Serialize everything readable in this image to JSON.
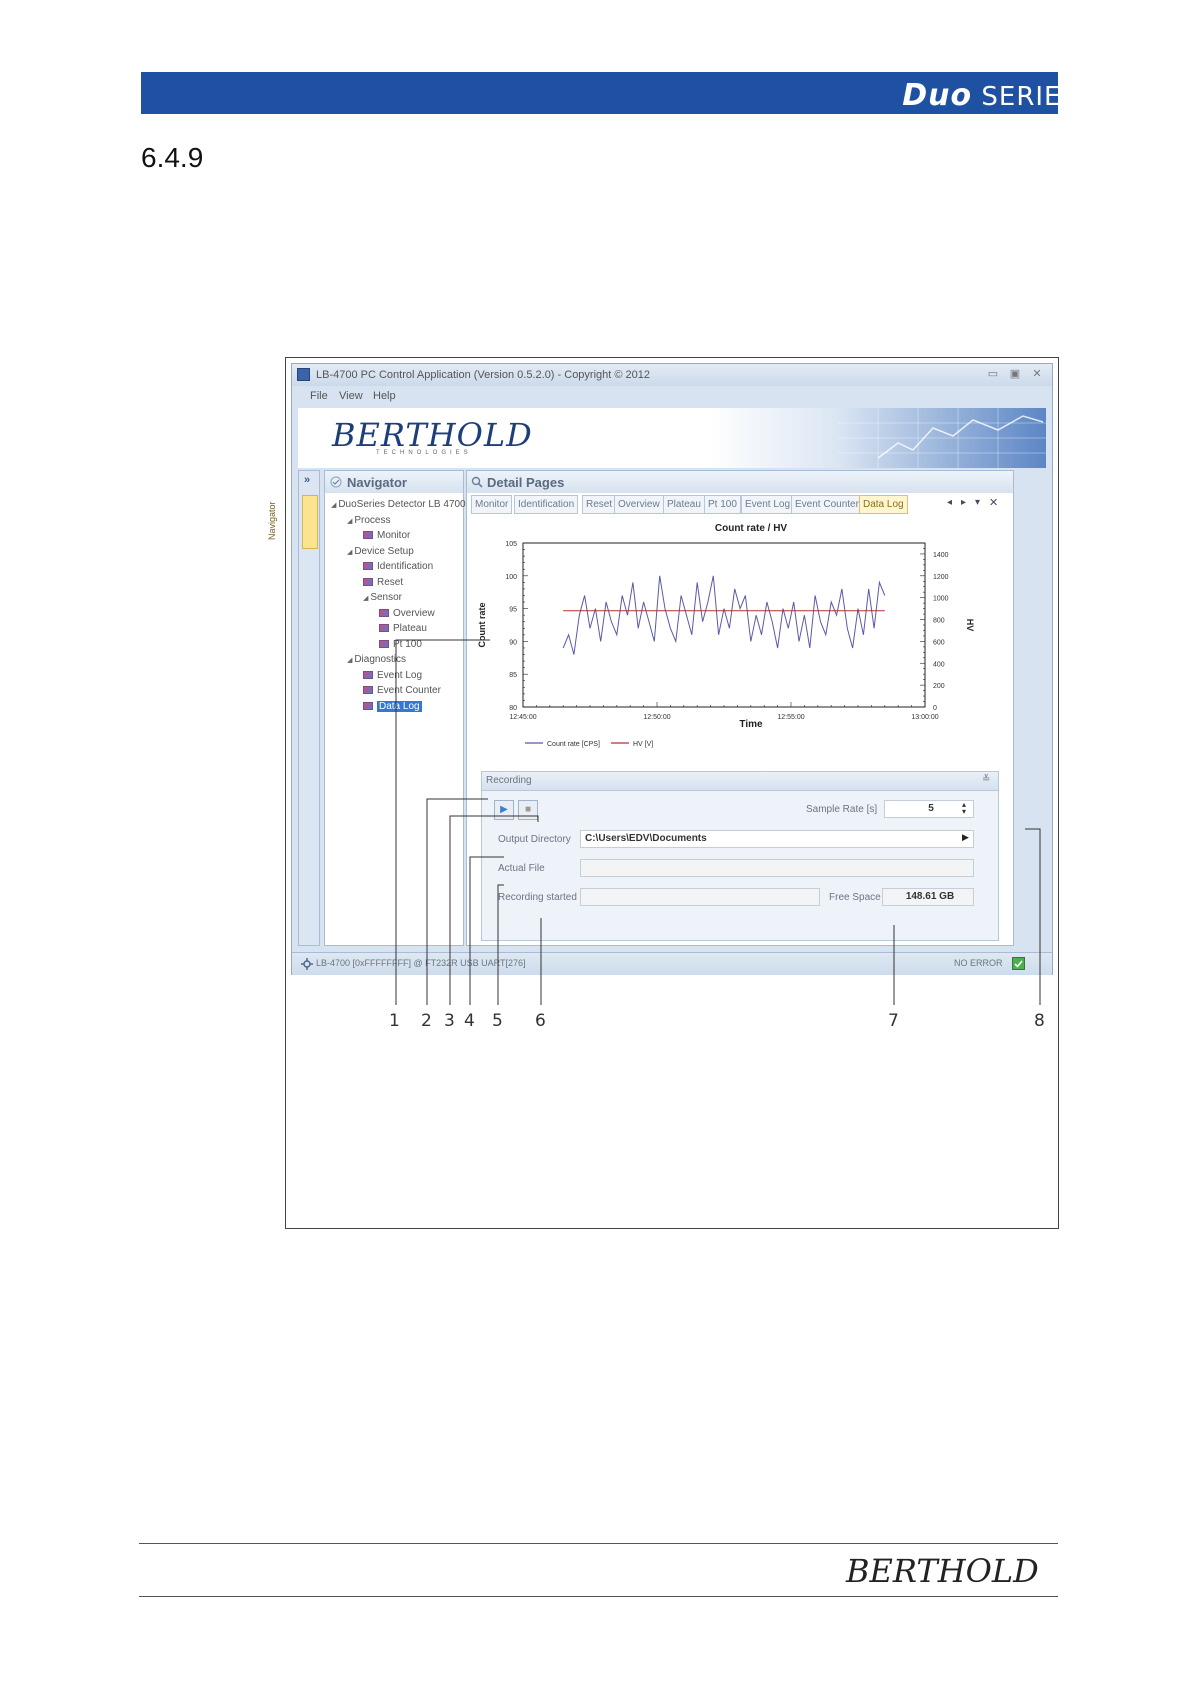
{
  "header": {
    "brand": "Duo",
    "series": "SERIES"
  },
  "section_number": "6.4.9",
  "window": {
    "title": "LB-4700 PC Control Application (Version 0.5.2.0) - Copyright © 2012",
    "controls": [
      "▭",
      "▣",
      "✕"
    ],
    "menu": [
      "File",
      "View",
      "Help"
    ],
    "logo": "BERTHOLD",
    "logo_sub": "TECHNOLOGIES"
  },
  "navigator": {
    "collapse_label": "»",
    "tab_label": "Navigator",
    "title": "Navigator",
    "tree": [
      {
        "label": "DuoSeries Detector LB 4700",
        "level": 0,
        "type": "folder"
      },
      {
        "label": "Process",
        "level": 1,
        "type": "folder"
      },
      {
        "label": "Monitor",
        "level": 2,
        "type": "page"
      },
      {
        "label": "Device Setup",
        "level": 1,
        "type": "folder"
      },
      {
        "label": "Identification",
        "level": 2,
        "type": "page"
      },
      {
        "label": "Reset",
        "level": 2,
        "type": "page"
      },
      {
        "label": "Sensor",
        "level": 2,
        "type": "folder"
      },
      {
        "label": "Overview",
        "level": 3,
        "type": "page"
      },
      {
        "label": "Plateau",
        "level": 3,
        "type": "page"
      },
      {
        "label": "Pt 100",
        "level": 3,
        "type": "page"
      },
      {
        "label": "Diagnostics",
        "level": 1,
        "type": "folder"
      },
      {
        "label": "Event Log",
        "level": 2,
        "type": "page"
      },
      {
        "label": "Event Counter",
        "level": 2,
        "type": "page"
      },
      {
        "label": "Data Log",
        "level": 2,
        "type": "page",
        "selected": true
      }
    ]
  },
  "detail": {
    "title": "Detail Pages",
    "tabs": [
      "Monitor",
      "Identification",
      "Reset",
      "Overview",
      "Plateau",
      "Pt 100",
      "Event Log",
      "Event Counter",
      "Data Log"
    ],
    "active_tab": "Data Log",
    "tab_controls": [
      "◂",
      "▸",
      "▾",
      "✕"
    ]
  },
  "chart_data": {
    "type": "line",
    "title": "Count rate / HV",
    "xlabel": "Time",
    "ylabel": "Count rate",
    "y2label": "HV",
    "x_ticks": [
      "12:45:00",
      "12:50:00",
      "12:55:00",
      "13:00:00"
    ],
    "y_ticks": [
      80,
      85,
      90,
      95,
      100,
      105
    ],
    "y2_ticks": [
      0,
      200,
      400,
      600,
      800,
      1000,
      1200,
      1400
    ],
    "ylim": [
      80,
      105
    ],
    "y2lim": [
      0,
      1500
    ],
    "xlim_min": [
      0,
      15
    ],
    "legend": [
      "Count rate [CPS]",
      "HV [V]"
    ],
    "colors": {
      "count": "#5a5aa8",
      "hv": "#b03030"
    },
    "series": [
      {
        "name": "Count rate [CPS]",
        "axis": "left",
        "x_min": [
          1.5,
          1.7,
          1.9,
          2.1,
          2.3,
          2.5,
          2.7,
          2.9,
          3.1,
          3.3,
          3.5,
          3.7,
          3.9,
          4.1,
          4.3,
          4.5,
          4.7,
          4.9,
          5.1,
          5.3,
          5.5,
          5.7,
          5.9,
          6.1,
          6.3,
          6.5,
          6.7,
          6.9,
          7.1,
          7.3,
          7.5,
          7.7,
          7.9,
          8.1,
          8.3,
          8.5,
          8.7,
          8.9,
          9.1,
          9.3,
          9.5,
          9.7,
          9.9,
          10.1,
          10.3,
          10.5,
          10.7,
          10.9,
          11.1,
          11.3,
          11.5,
          11.7,
          11.9,
          12.1,
          12.3,
          12.5,
          12.7,
          12.9,
          13.1,
          13.3,
          13.5
        ],
        "values": [
          89,
          91,
          88,
          94,
          97,
          92,
          95,
          90,
          96,
          93,
          91,
          97,
          94,
          99,
          92,
          96,
          93,
          90,
          100,
          95,
          92,
          90,
          97,
          94,
          91,
          99,
          93,
          96,
          100,
          91,
          95,
          92,
          98,
          95,
          97,
          90,
          94,
          91,
          96,
          93,
          89,
          95,
          92,
          96,
          90,
          94,
          89,
          97,
          93,
          91,
          96,
          94,
          98,
          92,
          89,
          95,
          91,
          98,
          92,
          99,
          97
        ]
      },
      {
        "name": "HV [V]",
        "axis": "right",
        "x_min": [
          1.5,
          13.5
        ],
        "values": [
          880,
          880
        ]
      }
    ]
  },
  "recording": {
    "title": "Recording",
    "collapse": "≚",
    "play": "▶",
    "stop": "■",
    "sample_rate_label": "Sample Rate  [s]",
    "sample_rate_value": "5",
    "output_dir_label": "Output Directory",
    "output_dir_value": "C:\\Users\\EDV\\Documents",
    "actual_file_label": "Actual File",
    "actual_file_value": "",
    "rec_started_label": "Recording started",
    "rec_started_value": "",
    "free_space_label": "Free Space",
    "free_space_value": "148.61 GB"
  },
  "status": {
    "connection": "LB-4700 [0xFFFFFFFF] @ FT232R USB UART[276]",
    "state": "NO ERROR"
  },
  "callouts": [
    "1",
    "2",
    "3",
    "4",
    "5",
    "6",
    "7",
    "8"
  ],
  "footer": {
    "logo": "BERTHOLD"
  }
}
